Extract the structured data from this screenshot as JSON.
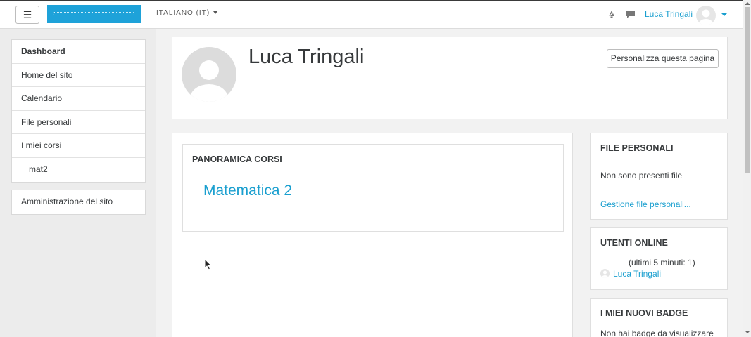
{
  "header": {
    "menu_icon": "☰",
    "language": "ITALIANO (IT)",
    "user_name": "Luca Tringali"
  },
  "nav": {
    "items": [
      {
        "label": "Dashboard"
      },
      {
        "label": "Home del sito"
      },
      {
        "label": "Calendario"
      },
      {
        "label": "File personali"
      },
      {
        "label": "I miei corsi"
      },
      {
        "label": "mat2"
      }
    ],
    "admin": "Amministrazione del sito"
  },
  "profile": {
    "name": "Luca Tringali",
    "customize_button": "Personalizza questa pagina"
  },
  "overview": {
    "title": "PANORAMICA CORSI",
    "course": "Matematica 2"
  },
  "files_block": {
    "title": "FILE PERSONALI",
    "empty_text": "Non sono presenti file",
    "manage_link": "Gestione file personali..."
  },
  "online_block": {
    "title": "UTENTI ONLINE",
    "period": "(ultimi 5 minuti: 1)",
    "user": "Luca Tringali"
  },
  "badges_block": {
    "title": "I MIEI NUOVI BADGE",
    "empty_text": "Non hai badge da visualizzare"
  },
  "colors": {
    "accent": "#1a9fcf",
    "logo": "#1ea2d9"
  }
}
